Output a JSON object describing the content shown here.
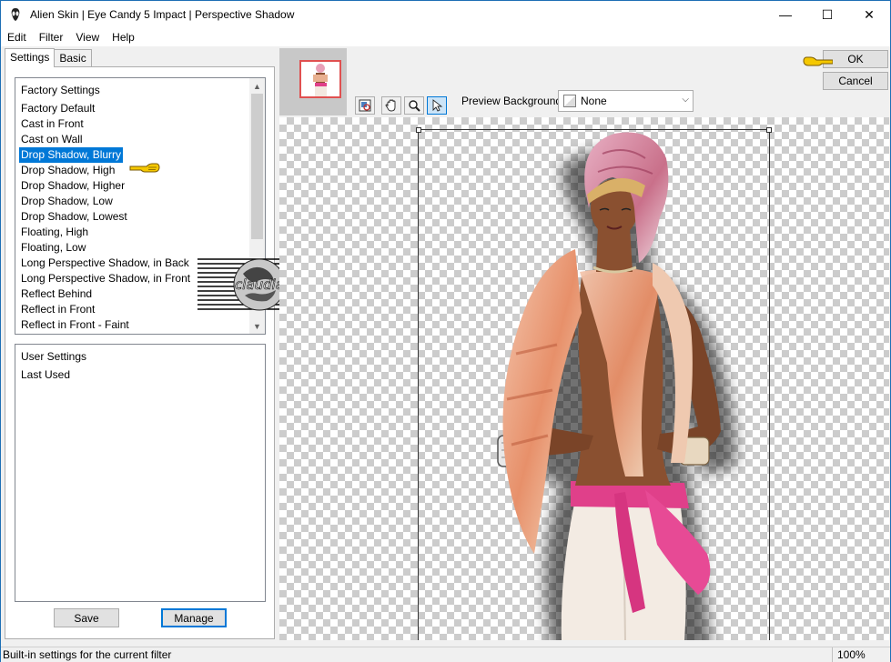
{
  "window": {
    "title": "Alien Skin | Eye Candy 5 Impact | Perspective Shadow",
    "minimize": "—",
    "maximize": "☐",
    "close": "✕"
  },
  "menu": [
    {
      "label": "Edit"
    },
    {
      "label": "Filter"
    },
    {
      "label": "View"
    },
    {
      "label": "Help"
    }
  ],
  "tabs": [
    {
      "label": "Settings",
      "active": true
    },
    {
      "label": "Basic",
      "active": false
    }
  ],
  "factory_settings": {
    "header": "Factory Settings",
    "items": [
      "Factory Default",
      "Cast in Front",
      "Cast on Wall",
      "Drop Shadow, Blurry",
      "Drop Shadow, High",
      "Drop Shadow, Higher",
      "Drop Shadow, Low",
      "Drop Shadow, Lowest",
      "Floating, High",
      "Floating, Low",
      "Long Perspective Shadow, in Back",
      "Long Perspective Shadow, in Front",
      "Reflect Behind",
      "Reflect in Front",
      "Reflect in Front - Faint"
    ],
    "selected_index": 3
  },
  "user_settings": {
    "header": "User Settings",
    "items": [
      "Last Used"
    ]
  },
  "buttons": {
    "save": "Save",
    "manage": "Manage",
    "ok": "OK",
    "cancel": "Cancel"
  },
  "preview": {
    "background_label": "Preview Background:",
    "background_value": "None"
  },
  "watermark": {
    "text": "claudia"
  },
  "status": {
    "text": "Built-in settings for the current filter",
    "zoom": "100%"
  },
  "colors": {
    "accent": "#0078d7",
    "pointer": "#f5c800"
  }
}
